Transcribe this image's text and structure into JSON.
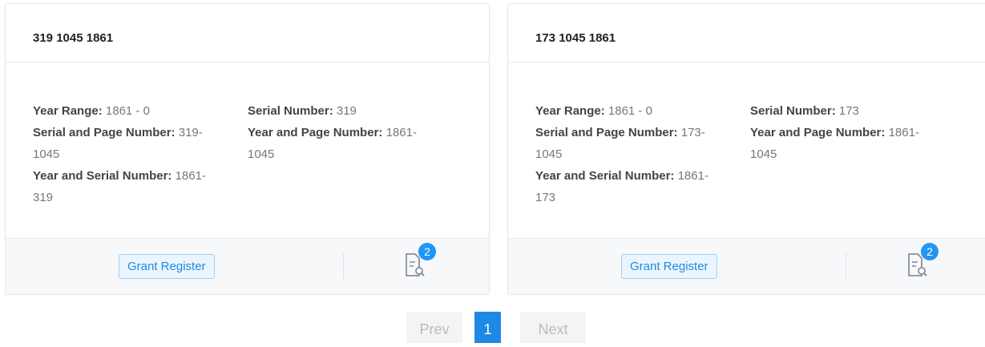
{
  "cards": [
    {
      "title": "319 1045 1861",
      "fields": {
        "year_range": {
          "label": "Year Range:",
          "value": "1861 - 0"
        },
        "serial_page": {
          "label": "Serial and Page Number:",
          "value": "319-",
          "value_cont": "1045"
        },
        "year_serial": {
          "label": "Year and Serial Number:",
          "value": "1861-",
          "value_cont": "319"
        },
        "serial_number": {
          "label": "Serial Number:",
          "value": "319"
        },
        "year_page": {
          "label": "Year and Page Number:",
          "value": "1861-",
          "value_cont": "1045"
        }
      },
      "tag": "Grant Register",
      "badge": "2"
    },
    {
      "title": "173 1045 1861",
      "fields": {
        "year_range": {
          "label": "Year Range:",
          "value": "1861 - 0"
        },
        "serial_page": {
          "label": "Serial and Page Number:",
          "value": "173-",
          "value_cont": "1045"
        },
        "year_serial": {
          "label": "Year and Serial Number:",
          "value": "1861-",
          "value_cont": "173"
        },
        "serial_number": {
          "label": "Serial Number:",
          "value": "173"
        },
        "year_page": {
          "label": "Year and Page Number:",
          "value": "1861-",
          "value_cont": "1045"
        }
      },
      "tag": "Grant Register",
      "badge": "2"
    }
  ],
  "pagination": {
    "prev": "Prev",
    "current": "1",
    "next": "Next"
  },
  "colors": {
    "accent": "#1e88e5",
    "badge": "#2196f3",
    "tag_border": "#9fd0f5"
  },
  "icons": {
    "document": "document-search-icon"
  }
}
